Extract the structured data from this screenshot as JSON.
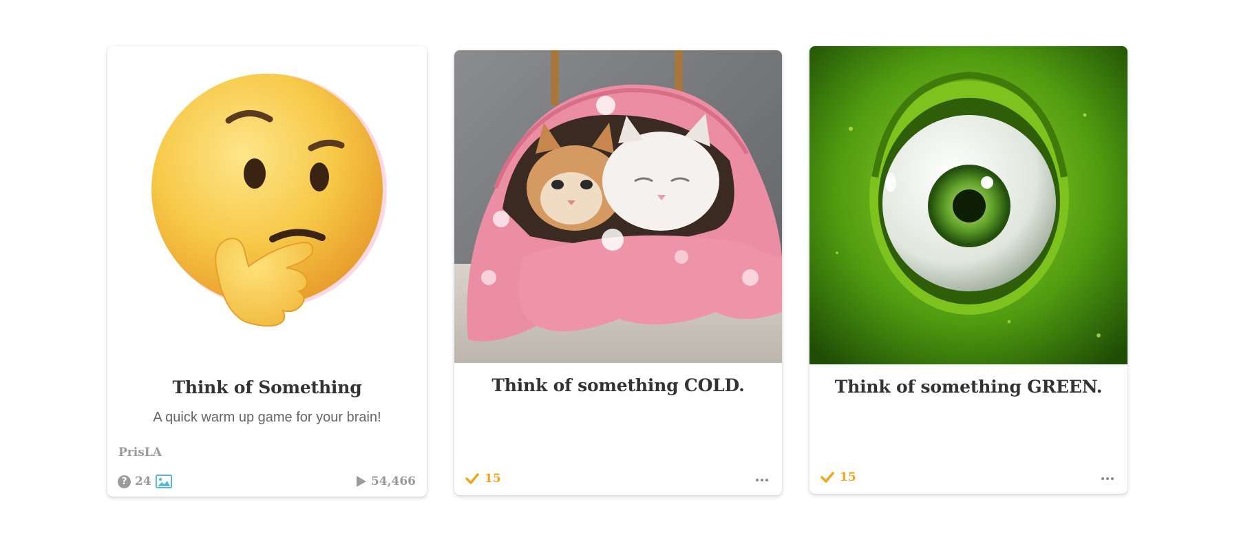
{
  "cards": [
    {
      "title": "Think of Something",
      "description": "A quick warm up game for your brain!",
      "author": "PrisLA",
      "question_count": "24",
      "question_icon": "question-circle-icon",
      "question_icon_glyph": "?",
      "image_icon": "image-icon",
      "play_icon": "play-icon",
      "plays": "54,466",
      "image": "thinking-face-emoji"
    },
    {
      "title": "Think of something COLD.",
      "completed_count": "15",
      "check_icon": "checkmark-icon",
      "more_icon": "more-dots-icon",
      "image": "kittens-in-pink-blanket"
    },
    {
      "title": "Think of something GREEN.",
      "completed_count": "15",
      "check_icon": "checkmark-icon",
      "more_icon": "more-dots-icon",
      "image": "green-monster-eye"
    }
  ],
  "colors": {
    "accent_orange": "#f2a51b",
    "muted_gray": "#9a9a9a",
    "title_text": "#333333",
    "image_icon_blue": "#5bb8d8"
  }
}
